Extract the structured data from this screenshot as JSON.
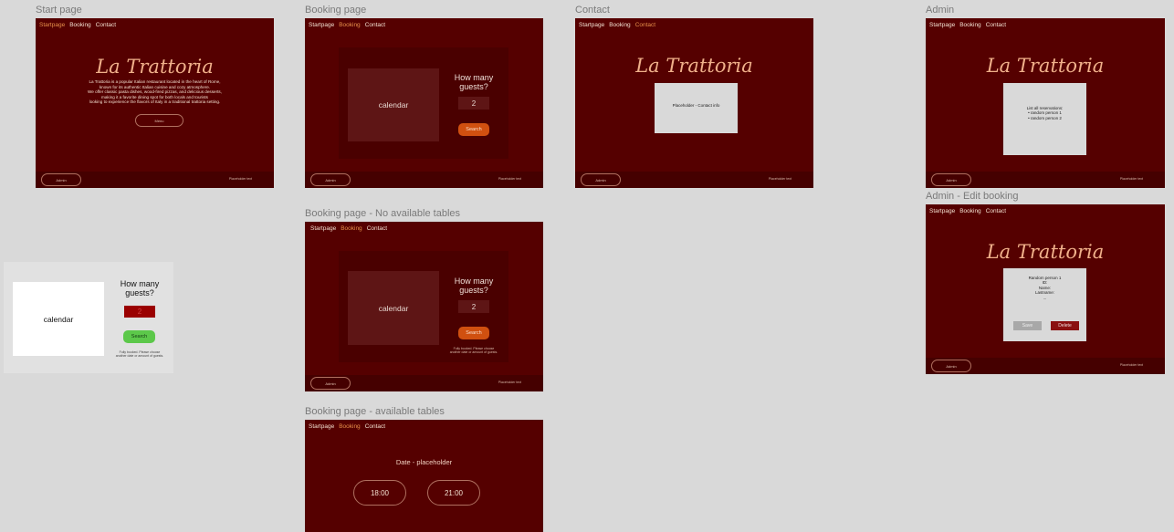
{
  "nav": {
    "startpage": "Startpage",
    "booking": "Booking",
    "contact": "Contact"
  },
  "logo": "La Trattoria",
  "footer": {
    "button_label": "Admin",
    "text": "Placeholder text"
  },
  "start_page": {
    "title": "Start page",
    "intro": [
      "La Trattoria is a popular Italian restaurant located in the heart of Rome,",
      "known for its authentic Italian cuisine and cozy atmosphere.",
      "We offer classic pasta dishes, wood-fired pizzas, and delicious desserts,",
      "making it a favorite dining spot for both locals and tourists",
      "looking to experience the flavors of Italy in a traditional trattoria setting."
    ],
    "menu_button": "Menu"
  },
  "booking_page": {
    "title": "Booking page",
    "calendar": "calendar",
    "question": "How many guests?",
    "guests": "2",
    "search": "Search"
  },
  "booking_no_tables": {
    "title": "Booking page - No available tables",
    "calendar": "calendar",
    "question": "How many guests?",
    "guests": "2",
    "search": "Search",
    "message": "Fully booked. Please choose another date or amount of guests."
  },
  "booking_available": {
    "title": "Booking page - available tables",
    "date": "Date - placeholder",
    "slots": [
      "18:00",
      "21:00"
    ]
  },
  "contact_page": {
    "title": "Contact",
    "box": "Placeholder - Contact info"
  },
  "admin_page": {
    "title": "Admin",
    "heading": "List all reservations:",
    "items": [
      "• random person 1",
      "• random person 2"
    ]
  },
  "admin_edit": {
    "title": "Admin - Edit booking",
    "lines": [
      "Random person 1",
      "ID:",
      "Name:",
      "Lastname:",
      "..."
    ],
    "save": "Save",
    "delete": "Delete"
  },
  "widget": {
    "calendar": "calendar",
    "question": "How many guests?",
    "guests": "2",
    "search": "Search",
    "message": "Fully booked. Please choose another date or amount of guests."
  }
}
